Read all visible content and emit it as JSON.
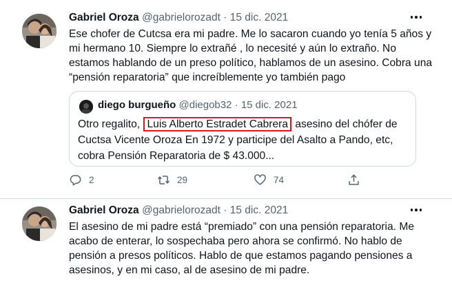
{
  "tweets": [
    {
      "author": {
        "name": "Gabriel Oroza",
        "handle": "@gabrielorozadt",
        "separator": "·",
        "date": "15 dic. 2021"
      },
      "lines": [
        "Ese chofer de Cutcsa era mi padre. Me lo sacaron cuando yo tenía 5 años y",
        "mi hermano 10. Siempre lo extrañé , lo necesité y aún lo extraño. No",
        "estamos hablando de un preso político, hablamos de un asesino. Cobra una",
        "“pensión reparatoria” que increíblemente yo también pago"
      ],
      "quote": {
        "author": {
          "name": "diego burgueño",
          "handle": "@diegob32",
          "separator": "·",
          "date": "15 dic. 2021"
        },
        "line1_before": "Otro regalito,",
        "line1_highlight": "Luis Alberto Estradet Cabrera",
        "line1_after": "asesino del chófer de",
        "line2": "Cuctsa Vicente Oroza En 1972 y participe del Asalto a Pando, etc,",
        "line3": "cobra Pensión Reparatoria de $ 43.000..."
      },
      "actions": {
        "replies": "2",
        "retweets": "29",
        "likes": "74"
      }
    },
    {
      "author": {
        "name": "Gabriel Oroza",
        "handle": "@gabrielorozadt",
        "separator": "·",
        "date": "15 dic. 2021"
      },
      "lines": [
        "El asesino de mi padre está “premiado” con una pensión reparatoria. Me",
        "acabo de enterar, lo sospechaba pero ahora se confirmó. No hablo de",
        "pensión a presos políticos. Hablo de que estamos pagando pensiones a",
        "asesinos, y en mi caso, al de asesino de mi padre."
      ]
    }
  ],
  "icons": {
    "more": "more-icon",
    "reply": "reply-icon",
    "retweet": "retweet-icon",
    "like": "heart-icon",
    "share": "share-icon"
  },
  "colors": {
    "text": "#0f1419",
    "secondary": "#536471",
    "border": "#cfd9de",
    "highlight_box": "#e0141b"
  }
}
